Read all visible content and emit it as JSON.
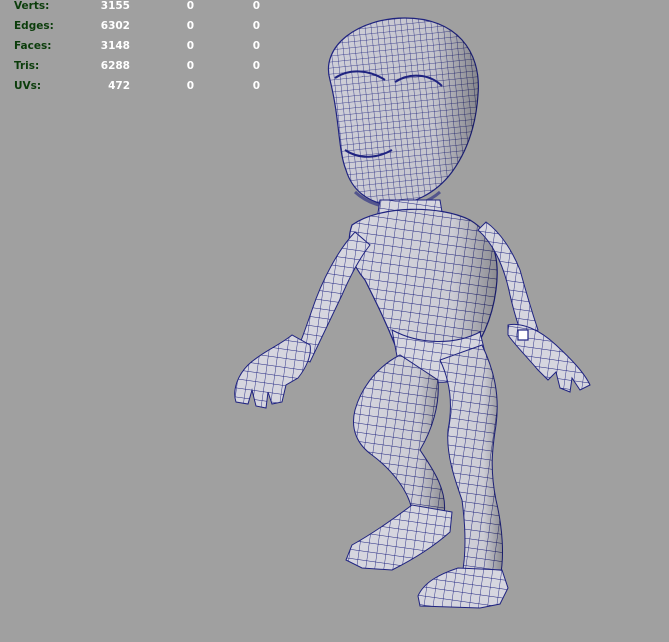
{
  "hud": {
    "rows": [
      {
        "label": "Verts:",
        "v1": "3155",
        "v2": "0",
        "v3": "0"
      },
      {
        "label": "Edges:",
        "v1": "6302",
        "v2": "0",
        "v3": "0"
      },
      {
        "label": "Faces:",
        "v1": "3148",
        "v2": "0",
        "v3": "0"
      },
      {
        "label": "Tris:",
        "v1": "6288",
        "v2": "0",
        "v3": "0"
      },
      {
        "label": "UVs:",
        "v1": "472",
        "v2": "0",
        "v3": "0"
      }
    ]
  },
  "colors": {
    "background": "#a0a0a0",
    "label": "#0b3d0b",
    "value": "#ffffff",
    "wireframe": "#1c1c7a",
    "surface": "#d8d8e0"
  }
}
